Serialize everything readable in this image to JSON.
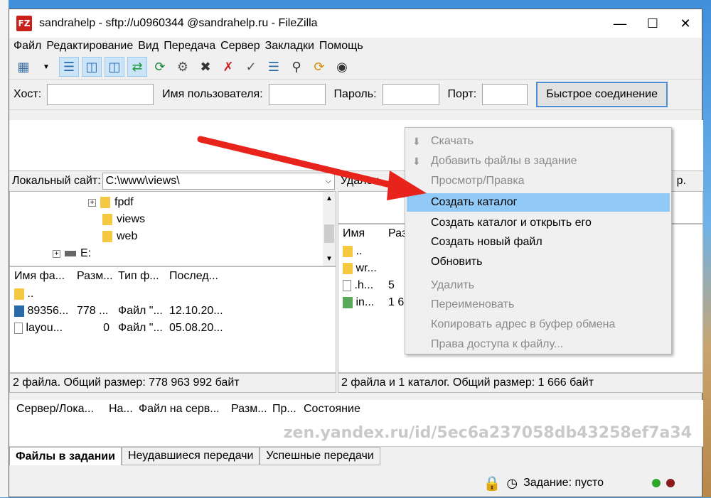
{
  "window": {
    "title": "sandrahelp - sftp://u0960344 @sandrahelp.ru - FileZilla",
    "icon": "FZ"
  },
  "menu": [
    "Файл",
    "Редактирование",
    "Вид",
    "Передача",
    "Сервер",
    "Закладки",
    "Помощь"
  ],
  "quickconnect": {
    "host_label": "Хост:",
    "user_label": "Имя пользователя:",
    "pass_label": "Пароль:",
    "port_label": "Порт:",
    "button": "Быстрое соединение"
  },
  "local": {
    "site_label": "Локальный сайт:",
    "path": "C:\\www\\views\\",
    "tree": [
      "fpdf",
      "views",
      "web",
      "E:"
    ],
    "headers": [
      "Имя фа...",
      "Разм...",
      "Тип ф...",
      "Послед..."
    ],
    "files": [
      {
        "name": "..",
        "size": "",
        "type": "",
        "date": ""
      },
      {
        "name": "89356...",
        "size": "778 ...",
        "type": "Файл \"...",
        "date": "12.10.20..."
      },
      {
        "name": "layou...",
        "size": "0",
        "type": "Файл \"...",
        "date": "05.08.20..."
      }
    ],
    "status": "2 файла. Общий размер: 778 963 992 байт"
  },
  "remote": {
    "site_label": "Удален",
    "site_suffix": "р.",
    "headers": [
      "Имя",
      "Раз"
    ],
    "files": [
      {
        "name": "..",
        "size": ""
      },
      {
        "name": "wr...",
        "size": ""
      },
      {
        "name": ".h...",
        "size": "5"
      },
      {
        "name": "in...",
        "size": "1 6"
      }
    ],
    "status": "2 файла и 1 каталог. Общий размер: 1 666 байт"
  },
  "context_menu": [
    {
      "label": "Скачать",
      "disabled": true,
      "icon": "download-icon"
    },
    {
      "label": "Добавить файлы в задание",
      "disabled": true,
      "icon": "add-queue-icon"
    },
    {
      "label": "Просмотр/Правка",
      "disabled": true
    },
    {
      "label": "Создать каталог",
      "disabled": false,
      "highlighted": true
    },
    {
      "label": "Создать каталог и открыть его",
      "disabled": false
    },
    {
      "label": "Создать новый файл",
      "disabled": false
    },
    {
      "label": "Обновить",
      "disabled": false
    },
    {
      "label": "Удалить",
      "disabled": true
    },
    {
      "label": "Переименовать",
      "disabled": true
    },
    {
      "label": "Копировать адрес в буфер обмена",
      "disabled": true
    },
    {
      "label": "Права доступа к файлу...",
      "disabled": true
    }
  ],
  "queue": {
    "headers": [
      "Сервер/Лока...",
      "На...",
      "Файл на серв...",
      "Разм...",
      "Пр...",
      "Состояние"
    ],
    "tabs": [
      "Файлы в задании",
      "Неудавшиеся передачи",
      "Успешные передачи"
    ],
    "status": "Задание: пусто"
  },
  "watermark": "zen.yandex.ru/id/5ec6a237058db43258ef7a34",
  "colors": {
    "highlight": "#91c9f7",
    "arrow": "#e8231c",
    "accent": "#4a8fd7"
  }
}
